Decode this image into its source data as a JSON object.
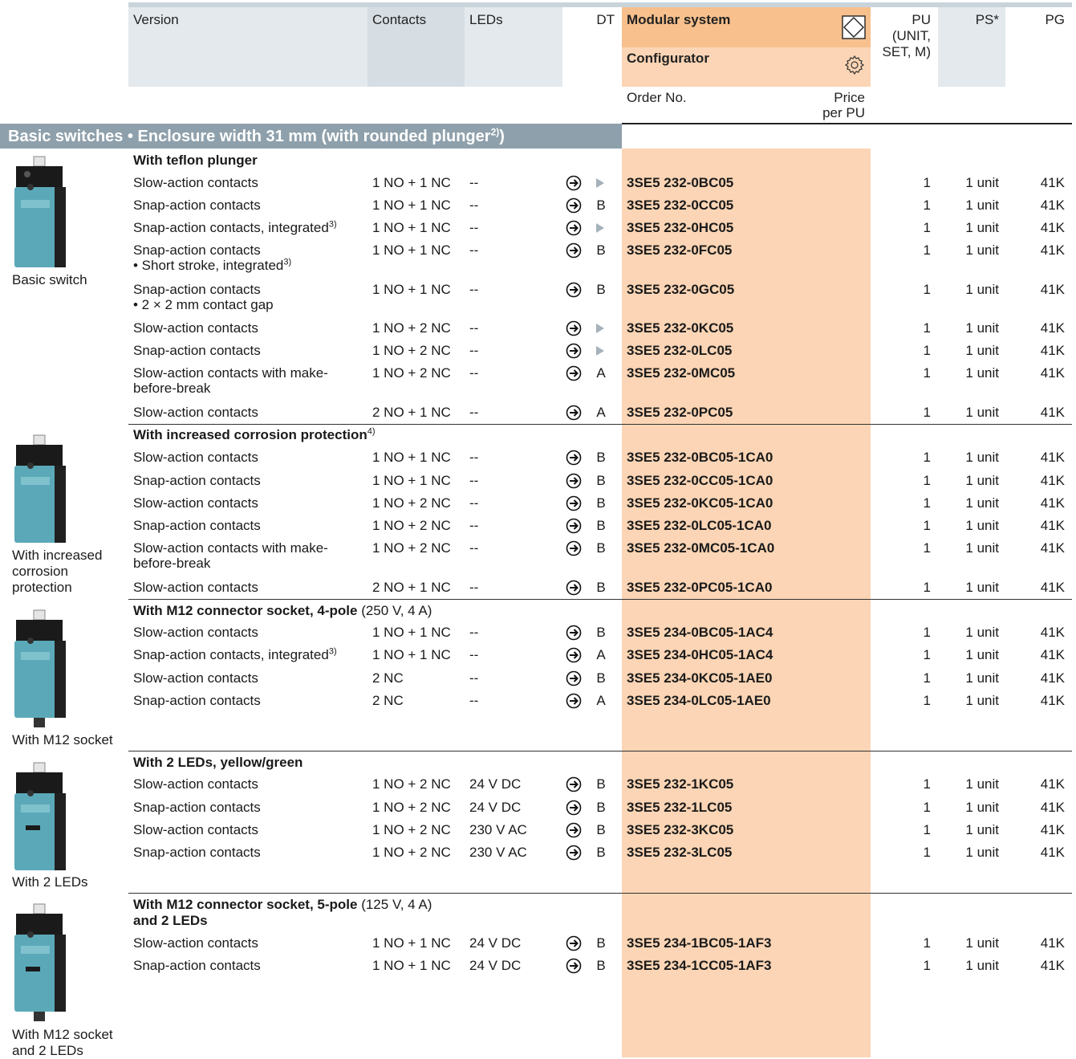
{
  "header": {
    "version": "Version",
    "contacts": "Contacts",
    "leds": "LEDs",
    "dt": "DT",
    "modular": "Modular system",
    "configurator": "Configurator",
    "order_no": "Order No.",
    "price": "Price",
    "per_pu": "per PU",
    "pu_line1": "PU",
    "pu_line2": "(UNIT,",
    "pu_line3": "SET, M)",
    "ps": "PS*",
    "pg": "PG",
    "modular_icon": "modular-system-icon",
    "configurator_icon": "gear-icon"
  },
  "section": {
    "title": "Basic switches • Enclosure width 31 mm (with rounded plunger",
    "sup": "2)",
    "close": ")"
  },
  "colors": {
    "header_grey": "#e3e9ed",
    "orange": "#fbd5b5",
    "orange_dark": "#f7c08d",
    "section_bar": "#8ea0ab"
  },
  "groups": [
    {
      "title": "With teflon plunger",
      "sup": "",
      "extra": "",
      "caption": "Basic switch",
      "image": "basic-switch-image"
    },
    {
      "title": "With increased corrosion protection",
      "sup": "4)",
      "extra": "",
      "caption": "With increased corrosion protection",
      "image": "corrosion-switch-image"
    },
    {
      "title": "With M12 connector socket, 4-pole",
      "sup": "",
      "extra": " (250 V, 4 A)",
      "caption": "With M12 socket",
      "image": "m12-socket-switch-image"
    },
    {
      "title": "With 2 LEDs, yellow/green",
      "sup": "",
      "extra": "",
      "caption": "With 2 LEDs",
      "image": "led-switch-image"
    },
    {
      "title": "With M12 connector socket, 5-pole",
      "sup": "",
      "extra": " (125 V, 4 A)",
      "title2": "and 2 LEDs",
      "caption": "With M12 socket and 2 LEDs",
      "image": "m12-led-switch-image"
    }
  ],
  "rows": [
    {
      "version": "Slow-action contacts",
      "contacts": "1 NO + 1 NC",
      "leds": "--",
      "dt": "►",
      "order": "3SE5 232-0BC05",
      "pu": "1",
      "ps": "1 unit",
      "pg": "41K"
    },
    {
      "version": "Snap-action contacts",
      "contacts": "1 NO + 1 NC",
      "leds": "--",
      "dt": "B",
      "order": "3SE5 232-0CC05",
      "pu": "1",
      "ps": "1 unit",
      "pg": "41K"
    },
    {
      "version": "Snap-action contacts, integrated",
      "sup": "3)",
      "contacts": "1 NO + 1 NC",
      "leds": "--",
      "dt": "►",
      "order": "3SE5 232-0HC05",
      "pu": "1",
      "ps": "1 unit",
      "pg": "41K"
    },
    {
      "version": "Snap-action contacts",
      "version2": "• Short stroke, integrated",
      "sup2": "3)",
      "contacts": "1 NO + 1 NC",
      "leds": "--",
      "dt": "B",
      "order": "3SE5 232-0FC05",
      "pu": "1",
      "ps": "1 unit",
      "pg": "41K"
    },
    {
      "version": "Snap-action contacts",
      "version2": "• 2 × 2 mm contact gap",
      "contacts": "1 NO + 1 NC",
      "leds": "--",
      "dt": "B",
      "order": "3SE5 232-0GC05",
      "pu": "1",
      "ps": "1 unit",
      "pg": "41K"
    },
    {
      "version": "Slow-action contacts",
      "contacts": "1 NO + 2 NC",
      "leds": "--",
      "dt": "►",
      "order": "3SE5 232-0KC05",
      "pu": "1",
      "ps": "1 unit",
      "pg": "41K"
    },
    {
      "version": "Snap-action contacts",
      "contacts": "1 NO + 2 NC",
      "leds": "--",
      "dt": "►",
      "order": "3SE5 232-0LC05",
      "pu": "1",
      "ps": "1 unit",
      "pg": "41K"
    },
    {
      "version": "Slow-action contacts with make-",
      "version2": "before-break",
      "contacts": "1 NO + 2 NC",
      "leds": "--",
      "dt": "A",
      "order": "3SE5 232-0MC05",
      "pu": "1",
      "ps": "1 unit",
      "pg": "41K"
    },
    {
      "version": "Slow-action contacts",
      "contacts": "2 NO + 1 NC",
      "leds": "--",
      "dt": "A",
      "order": "3SE5 232-0PC05",
      "pu": "1",
      "ps": "1 unit",
      "pg": "41K"
    },
    {
      "version": "Slow-action contacts",
      "contacts": "1 NO + 1 NC",
      "leds": "--",
      "dt": "B",
      "order": "3SE5 232-0BC05-1CA0",
      "pu": "1",
      "ps": "1 unit",
      "pg": "41K"
    },
    {
      "version": "Snap-action contacts",
      "contacts": "1 NO + 1 NC",
      "leds": "--",
      "dt": "B",
      "order": "3SE5 232-0CC05-1CA0",
      "pu": "1",
      "ps": "1 unit",
      "pg": "41K"
    },
    {
      "version": "Slow-action contacts",
      "contacts": "1 NO + 2 NC",
      "leds": "--",
      "dt": "B",
      "order": "3SE5 232-0KC05-1CA0",
      "pu": "1",
      "ps": "1 unit",
      "pg": "41K"
    },
    {
      "version": "Snap-action contacts",
      "contacts": "1 NO + 2 NC",
      "leds": "--",
      "dt": "B",
      "order": "3SE5 232-0LC05-1CA0",
      "pu": "1",
      "ps": "1 unit",
      "pg": "41K"
    },
    {
      "version": "Slow-action contacts with make-",
      "version2": "before-break",
      "contacts": "1 NO + 2 NC",
      "leds": "--",
      "dt": "B",
      "order": "3SE5 232-0MC05-1CA0",
      "pu": "1",
      "ps": "1 unit",
      "pg": "41K"
    },
    {
      "version": "Slow-action contacts",
      "contacts": "2 NO + 1 NC",
      "leds": "--",
      "dt": "B",
      "order": "3SE5 232-0PC05-1CA0",
      "pu": "1",
      "ps": "1 unit",
      "pg": "41K"
    },
    {
      "version": "Slow-action contacts",
      "contacts": "1 NO + 1 NC",
      "leds": "--",
      "dt": "B",
      "order": "3SE5 234-0BC05-1AC4",
      "pu": "1",
      "ps": "1 unit",
      "pg": "41K"
    },
    {
      "version": "Snap-action contacts, integrated",
      "sup": "3)",
      "contacts": "1 NO + 1 NC",
      "leds": "--",
      "dt": "A",
      "order": "3SE5 234-0HC05-1AC4",
      "pu": "1",
      "ps": "1 unit",
      "pg": "41K"
    },
    {
      "version": "Slow-action contacts",
      "contacts": "2 NC",
      "leds": "--",
      "dt": "B",
      "order": "3SE5 234-0KC05-1AE0",
      "pu": "1",
      "ps": "1 unit",
      "pg": "41K"
    },
    {
      "version": "Snap-action contacts",
      "contacts": "2 NC",
      "leds": "--",
      "dt": "A",
      "order": "3SE5 234-0LC05-1AE0",
      "pu": "1",
      "ps": "1 unit",
      "pg": "41K"
    },
    {
      "version": "Slow-action contacts",
      "contacts": "1 NO + 2 NC",
      "leds": "24 V DC",
      "dt": "B",
      "order": "3SE5 232-1KC05",
      "pu": "1",
      "ps": "1 unit",
      "pg": "41K"
    },
    {
      "version": "Snap-action contacts",
      "contacts": "1 NO + 2 NC",
      "leds": "24 V DC",
      "dt": "B",
      "order": "3SE5 232-1LC05",
      "pu": "1",
      "ps": "1 unit",
      "pg": "41K"
    },
    {
      "version": "Slow-action contacts",
      "contacts": "1 NO + 2 NC",
      "leds": "230 V AC",
      "dt": "B",
      "order": "3SE5 232-3KC05",
      "pu": "1",
      "ps": "1 unit",
      "pg": "41K"
    },
    {
      "version": "Snap-action contacts",
      "contacts": "1 NO + 2 NC",
      "leds": "230 V AC",
      "dt": "B",
      "order": "3SE5 232-3LC05",
      "pu": "1",
      "ps": "1 unit",
      "pg": "41K"
    },
    {
      "version": "Slow-action contacts",
      "contacts": "1 NO + 1 NC",
      "leds": "24 V DC",
      "dt": "B",
      "order": "3SE5 234-1BC05-1AF3",
      "pu": "1",
      "ps": "1 unit",
      "pg": "41K"
    },
    {
      "version": "Snap-action contacts",
      "contacts": "1 NO + 1 NC",
      "leds": "24 V DC",
      "dt": "B",
      "order": "3SE5 234-1CC05-1AF3",
      "pu": "1",
      "ps": "1 unit",
      "pg": "41K"
    }
  ]
}
